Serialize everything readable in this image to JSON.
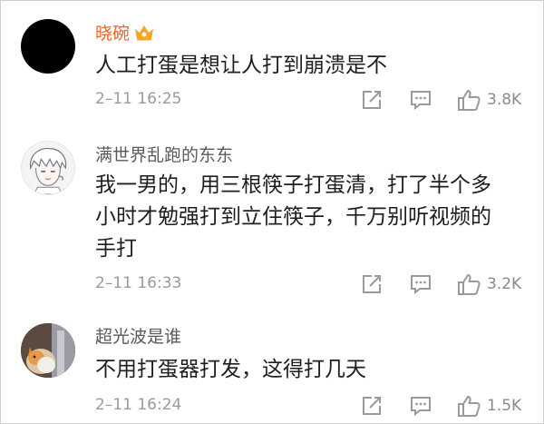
{
  "colors": {
    "username_primary": "#e8632a",
    "username_normal": "#5a5a5a",
    "text": "#1e1e1e",
    "meta": "#9a9a9a",
    "icon": "#9a9a9a",
    "crown": "#f5a623"
  },
  "comments": [
    {
      "username": "晓碗",
      "has_vip_crown": true,
      "avatar": "black-circle",
      "content": "人工打蛋是想让人打到崩溃是不",
      "time": "2–11 16:25",
      "likes": "3.8K"
    },
    {
      "username": "满世界乱跑的东东",
      "has_vip_crown": false,
      "avatar": "anime-boy-sketch",
      "content_lines": [
        "我一男的，用三根筷子打蛋清，打了半个多",
        "小时才勉强打到立住筷子，千万别听视频的",
        "手打"
      ],
      "time": "2–11 16:33",
      "likes": "3.2K"
    },
    {
      "username": "超光波是谁",
      "has_vip_crown": false,
      "avatar": "cat-photo",
      "content": "不用打蛋器打发，这得打几天",
      "time": "2–11 16:24",
      "likes": "1.5K"
    }
  ],
  "icons": {
    "share": "share-icon",
    "comment": "comment-icon",
    "like": "thumbs-up-icon",
    "crown": "crown-icon"
  }
}
